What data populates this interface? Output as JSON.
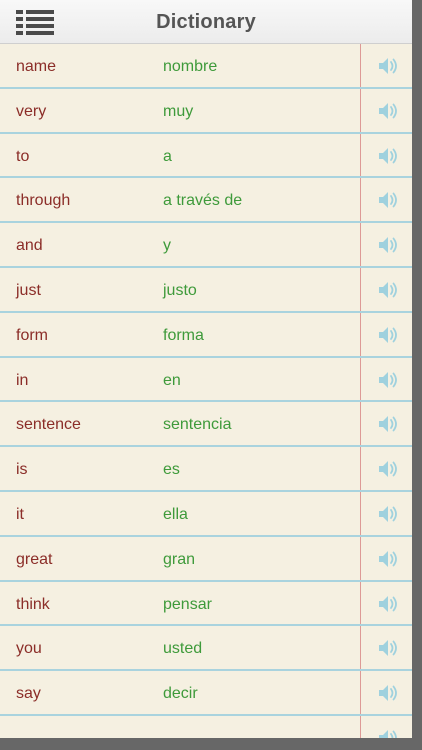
{
  "header": {
    "title": "Dictionary",
    "menu_icon": "list-menu-icon"
  },
  "speaker_icon": "speaker-icon",
  "colors": {
    "english_word": "#8b2d28",
    "spanish_word": "#3e9a3a",
    "row_rule": "#a9d3de",
    "margin_rule": "#dd9a96",
    "paper": "#f5f0e1"
  },
  "entries": [
    {
      "en": "name",
      "es": "nombre"
    },
    {
      "en": "very",
      "es": "muy"
    },
    {
      "en": "to",
      "es": "a"
    },
    {
      "en": "through",
      "es": "a través de"
    },
    {
      "en": "and",
      "es": "y"
    },
    {
      "en": "just",
      "es": "justo"
    },
    {
      "en": "form",
      "es": "forma"
    },
    {
      "en": "in",
      "es": "en"
    },
    {
      "en": "sentence",
      "es": "sentencia"
    },
    {
      "en": "is",
      "es": "es"
    },
    {
      "en": "it",
      "es": "ella"
    },
    {
      "en": "great",
      "es": "gran"
    },
    {
      "en": "think",
      "es": "pensar"
    },
    {
      "en": "you",
      "es": "usted"
    },
    {
      "en": "say",
      "es": "decir"
    },
    {
      "en": "",
      "es": ""
    }
  ]
}
